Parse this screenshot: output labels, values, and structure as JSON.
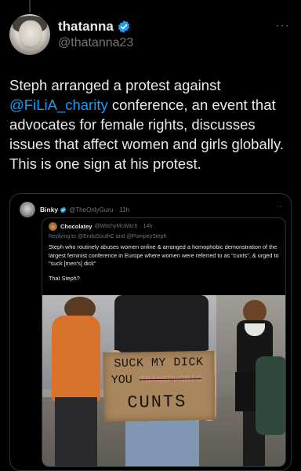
{
  "tweet": {
    "display_name": "thatanna",
    "handle": "@thatanna23",
    "more": "···",
    "text_before": "Steph arranged a protest against ",
    "mention": "@FiLiA_charity",
    "text_after": " conference, an event that advocates for female rights, discusses issues that affect women and girls globally. This is one sign at his protest."
  },
  "quote": {
    "display_name": "Binky",
    "handle": "@TheOnlyGuru",
    "time": "· 11h",
    "more": "···",
    "inner": {
      "display_name": "Chocolatey",
      "handle": "@WitchyMcWitch",
      "time": "· 14h",
      "replying_to": "Replying to @EndoSouthC and @PompeySteph",
      "text": "Steph who routinely abuses women online & arranged a homophobic demonstration of the largest feminist conference in Europe where women were referred to as \"cunts\", & urged to \"suck [men's] dick\"",
      "text2": "That Steph?",
      "sign": {
        "line1": "SUCK MY DICK",
        "line2_prefix": "YOU",
        "line2_struck": "TRANSPHOBIC",
        "line3": "CUNTS"
      }
    }
  },
  "colors": {
    "background": "#000000",
    "text": "#e7e9ea",
    "muted": "#71767b",
    "accent": "#1d9bf0",
    "border": "#2f3336"
  }
}
